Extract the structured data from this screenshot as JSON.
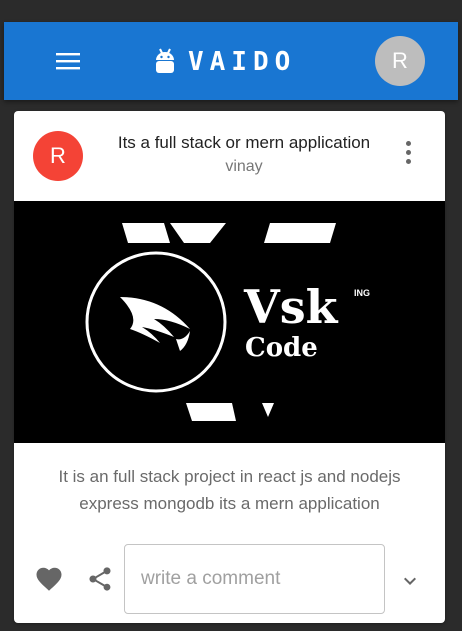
{
  "app": {
    "title": "VAIDO",
    "user_avatar_letter": "R",
    "accent_color": "#1976d2"
  },
  "post": {
    "author_avatar_letter": "R",
    "avatar_color": "#f44336",
    "title": "Its a full stack or mern application",
    "author": "vinay",
    "description": "It is an full stack project in react js and nodejs express mongodb its a mern application",
    "image": {
      "logo_text": "Vsk",
      "logo_sub": "Code",
      "logo_badge": "ING"
    }
  },
  "actions": {
    "comment_placeholder": "write a comment"
  },
  "icons": [
    "menu-icon",
    "android-icon",
    "more-vert-icon",
    "heart-icon",
    "share-icon",
    "chevron-down-icon"
  ]
}
